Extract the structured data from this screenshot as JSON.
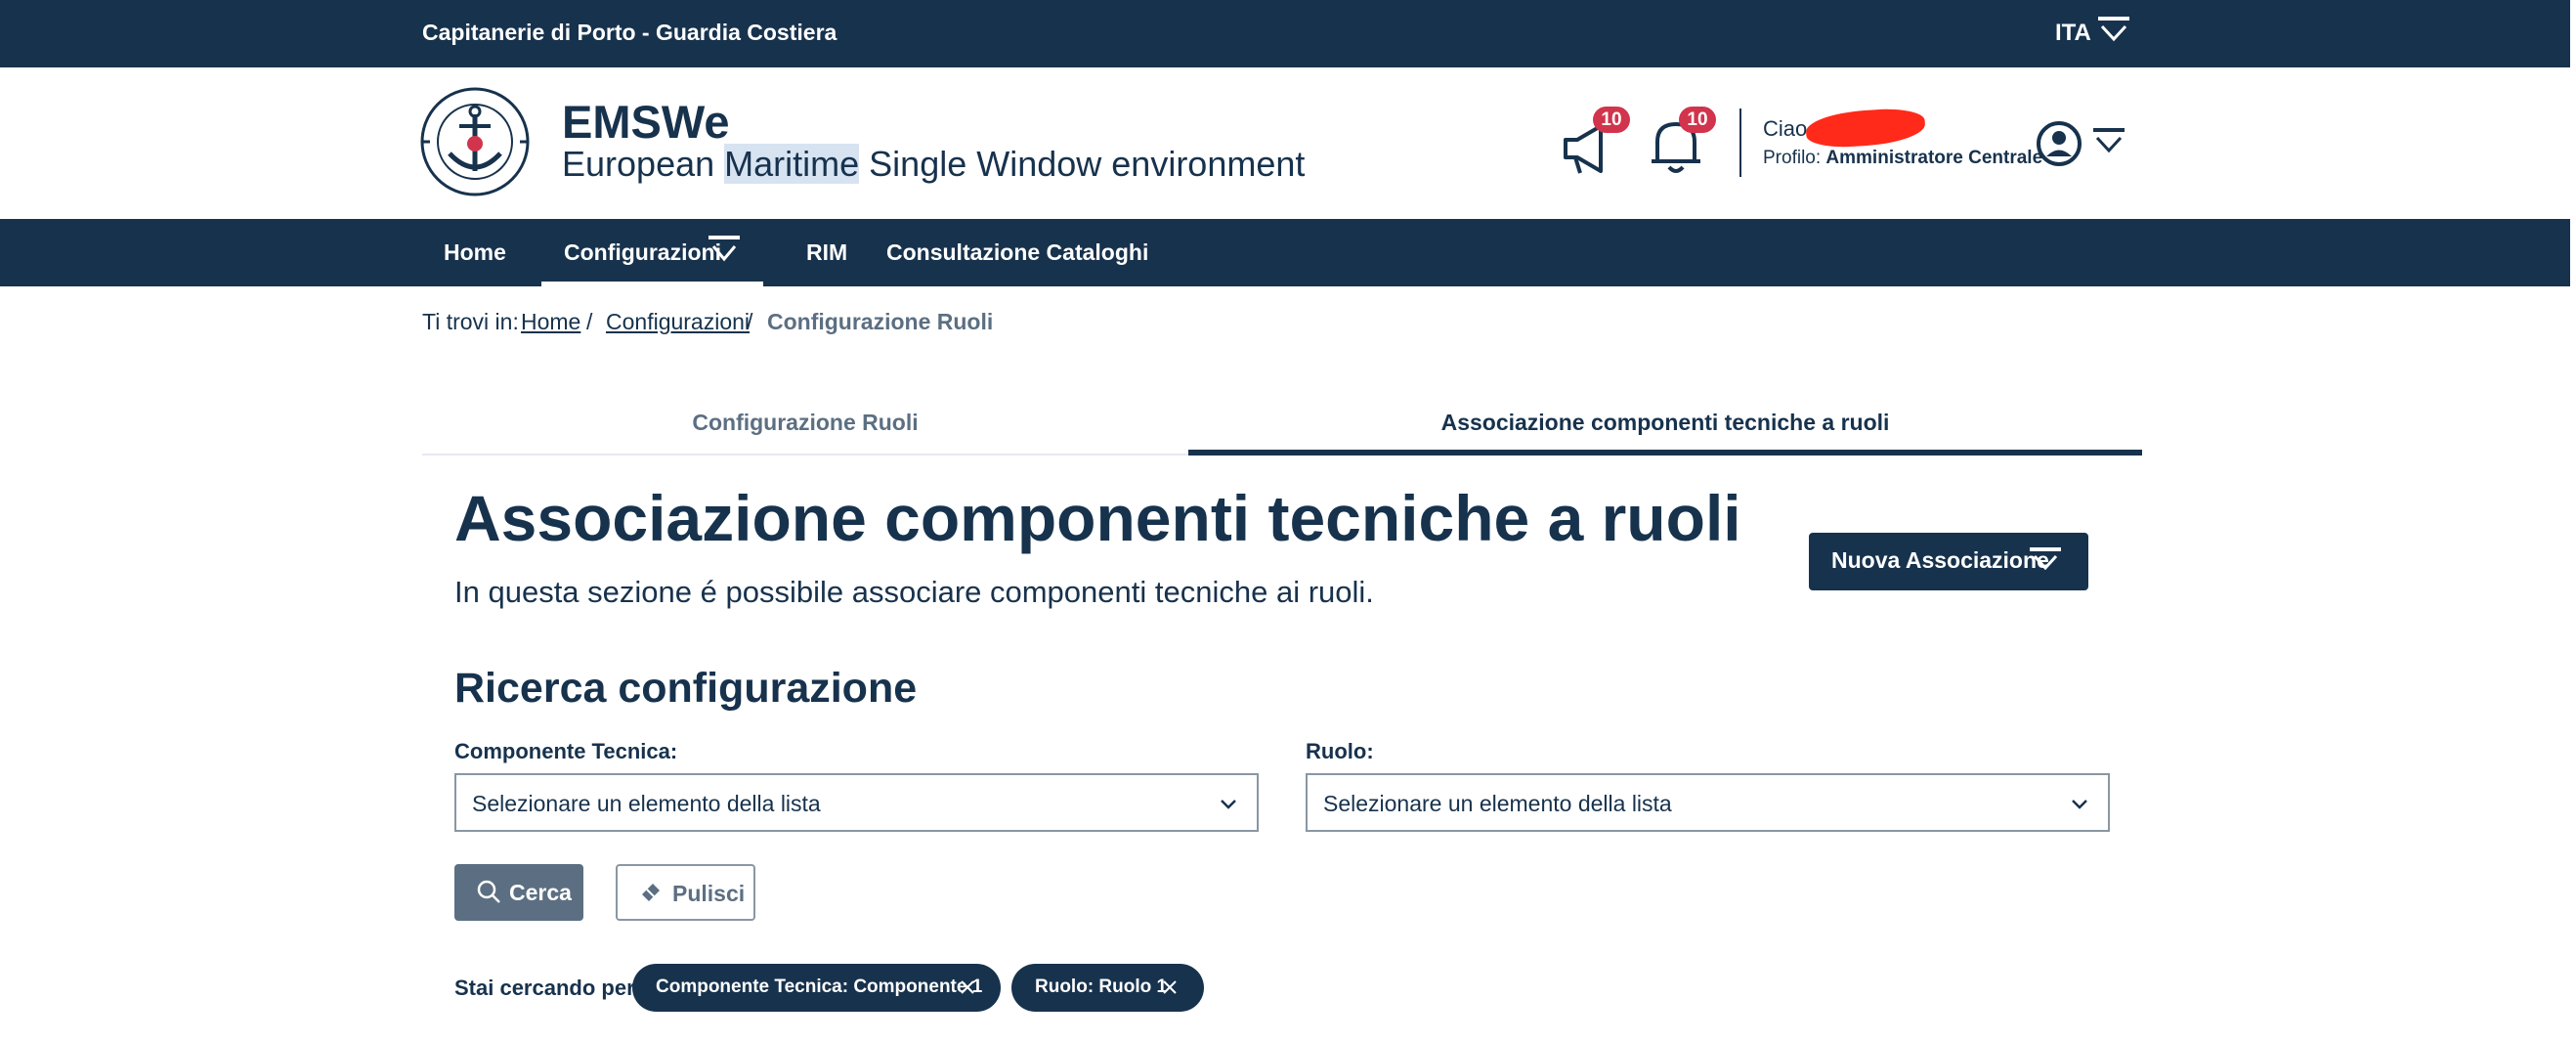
{
  "slim_header": {
    "brand": "Capitanerie di Porto - Guardia Costiera",
    "language": "ITA"
  },
  "center_header": {
    "title": "EMSWe",
    "subtitle_before": "European ",
    "subtitle_highlight": "Maritime",
    "subtitle_after": " Single Window environment",
    "notifications": {
      "announcements_count": "10",
      "alerts_count": "10"
    },
    "user": {
      "greeting": "Ciao,",
      "profile_label": "Profilo:",
      "profile_value": "Amministratore Centrale"
    }
  },
  "nav": {
    "items": [
      "Home",
      "Configurazioni",
      "RIM",
      "Consultazione Cataloghi"
    ],
    "active": "Configurazioni"
  },
  "breadcrumb": {
    "prefix": "Ti trovi in:",
    "items": [
      "Home",
      "Configurazioni",
      "Configurazione Ruoli"
    ],
    "separator": "/"
  },
  "tabs": [
    {
      "label": "Configurazione Ruoli",
      "active": false
    },
    {
      "label": "Associazione componenti tecniche a ruoli",
      "active": true
    }
  ],
  "page": {
    "title": "Associazione componenti tecniche a ruoli",
    "lead": "In questa sezione é possibile associare componenti tecniche ai ruoli.",
    "new_button": "Nuova Associazione"
  },
  "search": {
    "title": "Ricerca configurazione",
    "component_label": "Componente Tecnica:",
    "component_value": "Selezionare un elemento della lista",
    "role_label": "Ruolo:",
    "role_value": "Selezionare un elemento della lista",
    "search_button": "Cerca",
    "clear_button": "Pulisci",
    "active_filters_label": "Stai cercando per:",
    "chips": [
      "Componente Tecnica: Componente 1",
      "Ruolo: Ruolo 1"
    ]
  },
  "colors": {
    "primary": "#17324d",
    "badge": "#d1344c",
    "secondary_button": "#5c6f82"
  }
}
